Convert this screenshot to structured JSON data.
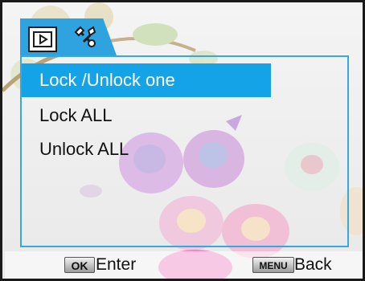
{
  "tabs": {
    "playback_icon": "playback-icon",
    "setup_icon": "setup-wrench-icon"
  },
  "menu": {
    "items": [
      {
        "label": "Lock /Unlock one",
        "selected": true
      },
      {
        "label": "Lock ALL",
        "selected": false
      },
      {
        "label": "Unlock ALL",
        "selected": false
      }
    ]
  },
  "footer": {
    "ok_badge": "OK",
    "ok_label": "Enter",
    "menu_badge": "MENU",
    "menu_label": "Back"
  },
  "colors": {
    "accent": "#14a3e6",
    "frame": "#35a8e2"
  }
}
